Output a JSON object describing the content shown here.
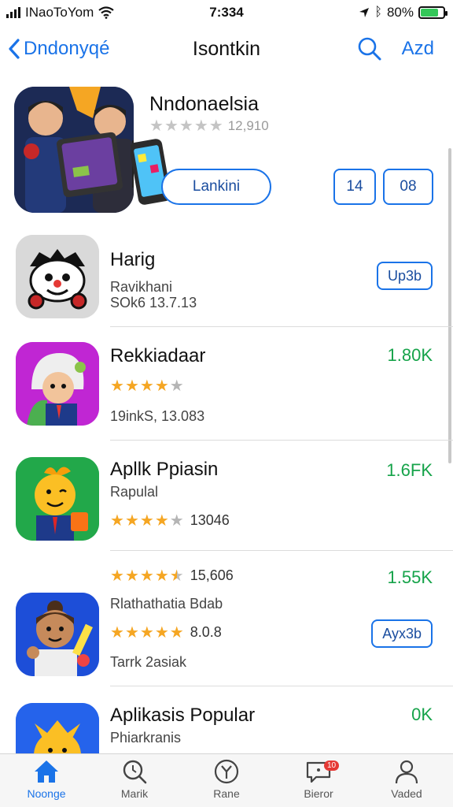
{
  "status_bar": {
    "carrier": "INaoToYom",
    "time": "7:334",
    "battery": "80%",
    "battery_level": 0.8
  },
  "nav": {
    "back_label": "Dndonyqé",
    "title": "Isontkin",
    "add_label": "Azd"
  },
  "featured": {
    "name": "Nndonaelsia",
    "rating": 0,
    "rating_count": "12,910",
    "get_label": "Lankini",
    "button_1": "14",
    "button_2": "08"
  },
  "rows": [
    {
      "name": "Harig",
      "sub1": "Ravikhani",
      "sub2": "SOk6 13.7.13",
      "button": "Up3b"
    },
    {
      "name": "Rekkiadaar",
      "price": "1.80K",
      "rating": 4,
      "sub": "19inkS, 13.083"
    },
    {
      "name": "Apllk Ppiasin",
      "sub": "Rapulal",
      "price": "1.6FK",
      "rating": 4,
      "rating_text": "13046"
    },
    {
      "rating": 4.5,
      "rating_text": "15,606",
      "price": "1.55K",
      "sub1": "Rlathathatia Bdab",
      "rating2": 5,
      "rating2_text": "8.0.8",
      "sub2": "Tarrk 2asiak",
      "button": "Ayx3b"
    },
    {
      "name": "Aplikasis Popular",
      "sub": "Phiarkranis",
      "price": "0K"
    }
  ],
  "tabs": [
    {
      "label": "Noonge",
      "icon": "home-icon",
      "active": true
    },
    {
      "label": "Marik",
      "icon": "search-icon"
    },
    {
      "label": "Rane",
      "icon": "star-icon"
    },
    {
      "label": "Bieror",
      "icon": "chat-icon",
      "badge": "10"
    },
    {
      "label": "Vaded",
      "icon": "person-icon"
    }
  ],
  "colors": {
    "accent": "#1a73e8",
    "price": "#16a34a",
    "star": "#f5a623"
  }
}
